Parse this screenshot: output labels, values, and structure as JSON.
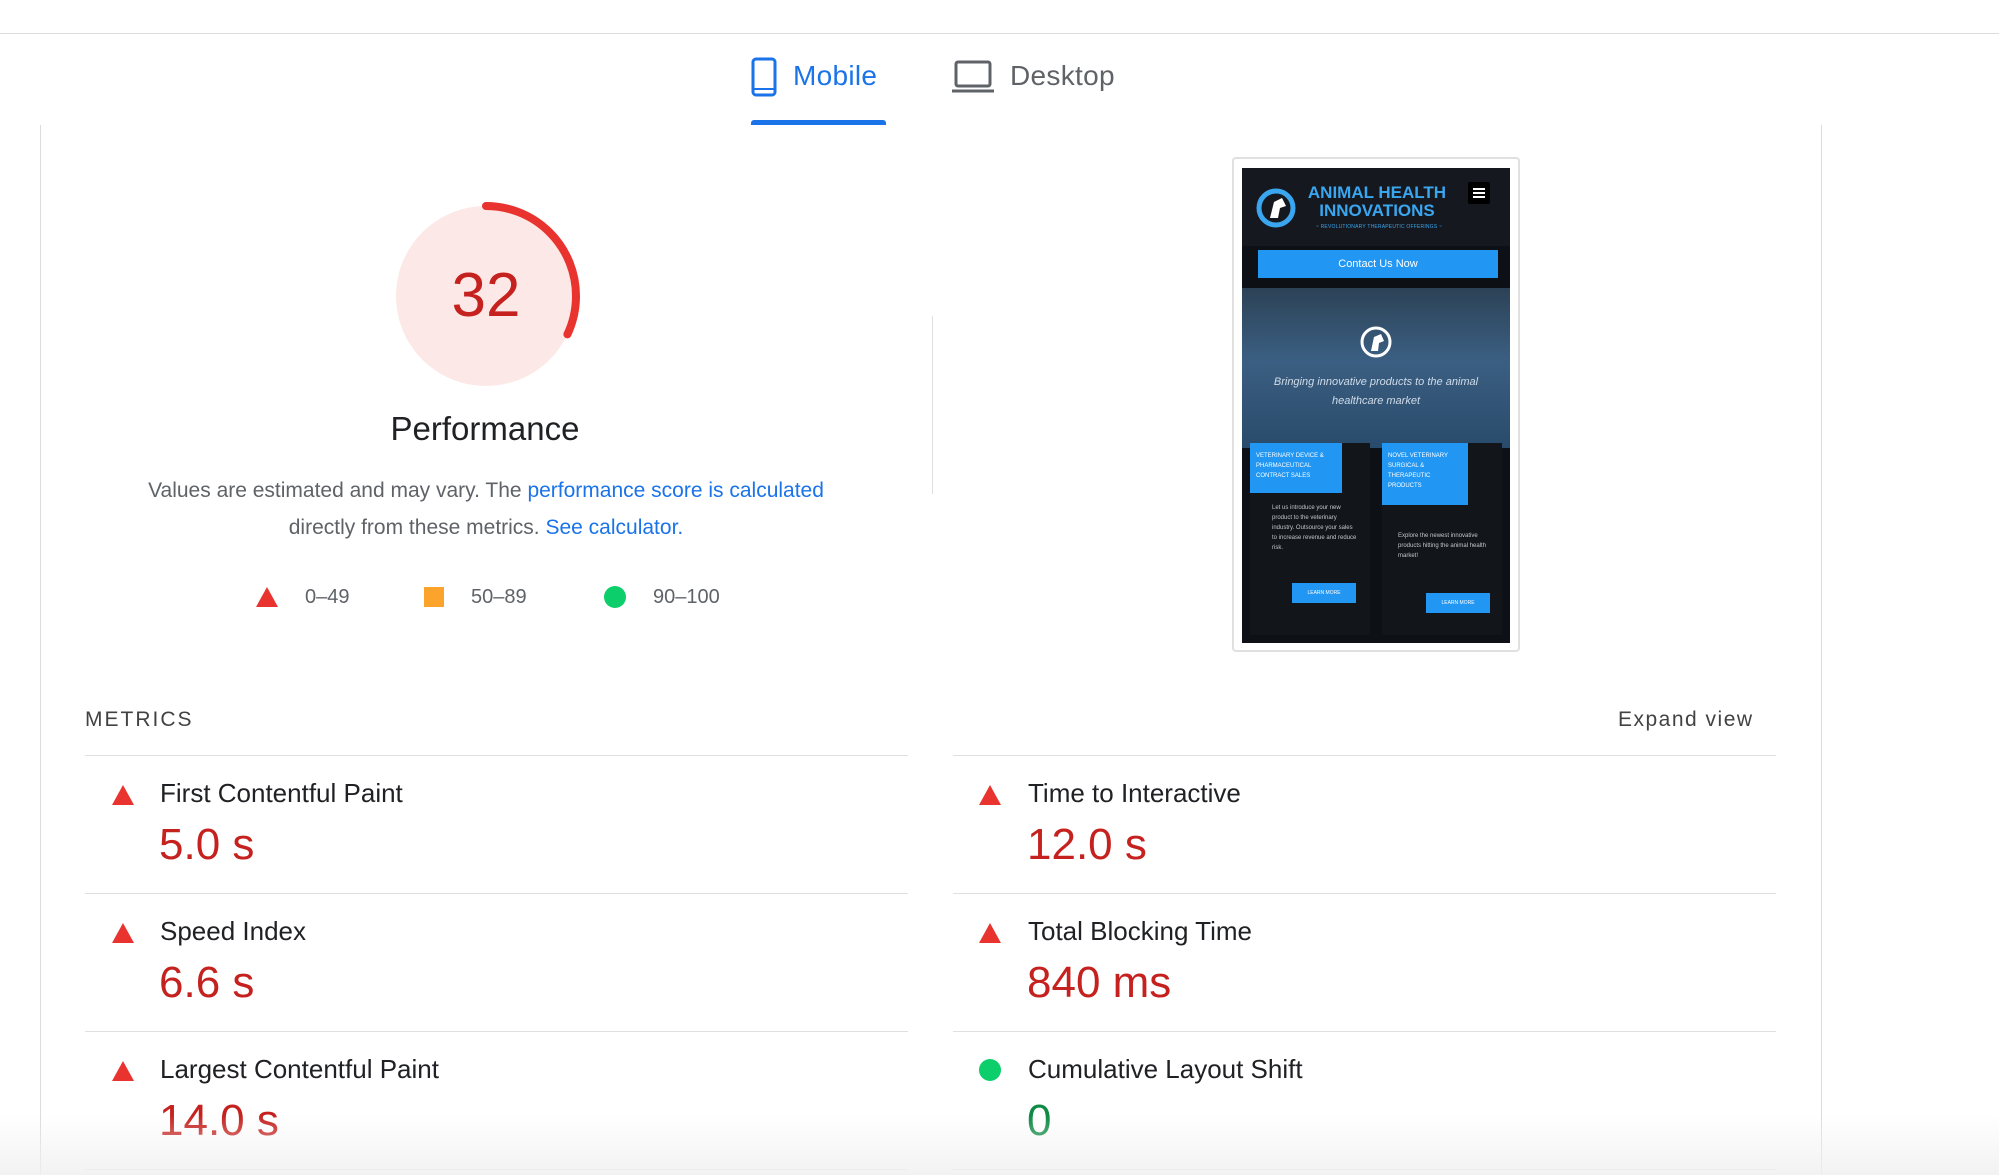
{
  "tabs": [
    {
      "label": "Mobile",
      "icon": "phone-icon",
      "active": true
    },
    {
      "label": "Desktop",
      "icon": "laptop-icon",
      "active": false
    }
  ],
  "performance": {
    "score": "32",
    "score_value": 32,
    "title": "Performance",
    "desc_prefix": "Values are estimated and may vary. The ",
    "desc_link1": "performance score is calculated",
    "desc_middle": " directly from these metrics. ",
    "desc_link2": "See calculator.",
    "color_fail": "#c5221f",
    "color_gauge_bg": "#fce8e6"
  },
  "legend": [
    {
      "range": "0–49",
      "shape": "triangle",
      "color": "#e8332f"
    },
    {
      "range": "50–89",
      "shape": "square",
      "color": "#fba32a"
    },
    {
      "range": "90–100",
      "shape": "circle",
      "color": "#0cce6b"
    }
  ],
  "preview": {
    "brand_line1": "ANIMAL HEALTH",
    "brand_line2": "INNOVATIONS",
    "brand_sub": "~ REVOLUTIONARY THERAPEUTIC OFFERINGS ~",
    "cta": "Contact Us Now",
    "hero_text": "Bringing innovative products to the animal healthcare market",
    "card1_head": "VETERINARY DEVICE & PHARMACEUTICAL CONTRACT SALES",
    "card1_body": "Let us introduce your new product to the veterinary industry. Outsource your sales to increase revenue and reduce risk.",
    "card2_head": "NOVEL VETERINARY SURGICAL & THERAPEUTIC PRODUCTS",
    "card2_body": "Explore the newest innovative products hitting the animal health market!",
    "learn_more": "LEARN MORE"
  },
  "metrics": {
    "title": "METRICS",
    "expand": "Expand view",
    "items": [
      {
        "name": "First Contentful Paint",
        "value": "5.0 s",
        "status": "fail"
      },
      {
        "name": "Time to Interactive",
        "value": "12.0 s",
        "status": "fail"
      },
      {
        "name": "Speed Index",
        "value": "6.6 s",
        "status": "fail"
      },
      {
        "name": "Total Blocking Time",
        "value": "840 ms",
        "status": "fail"
      },
      {
        "name": "Largest Contentful Paint",
        "value": "14.0 s",
        "status": "fail"
      },
      {
        "name": "Cumulative Layout Shift",
        "value": "0",
        "status": "pass"
      }
    ],
    "color_fail": "#c5221f",
    "color_pass": "#0d8a43"
  }
}
